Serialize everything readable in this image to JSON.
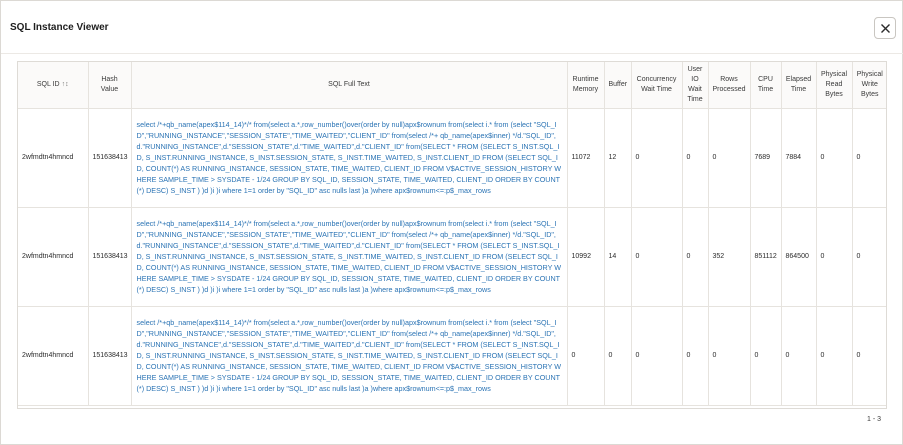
{
  "dialog": {
    "title": "SQL Instance Viewer",
    "close_icon": "close-icon"
  },
  "table": {
    "columns": [
      {
        "key": "sql_id",
        "label": "SQL ID"
      },
      {
        "key": "hash_value",
        "label": "Hash Value"
      },
      {
        "key": "sql_full_text",
        "label": "SQL Full Text"
      },
      {
        "key": "runtime_memory",
        "label": "Runtime Memory"
      },
      {
        "key": "buffer",
        "label": "Buffer"
      },
      {
        "key": "concurrency_wait_time",
        "label": "Concurrency Wait Time"
      },
      {
        "key": "user_io_wait_time",
        "label": "User IO Wait Time"
      },
      {
        "key": "rows_processed",
        "label": "Rows Processed"
      },
      {
        "key": "cpu_time",
        "label": "CPU Time"
      },
      {
        "key": "elapsed_time",
        "label": "Elapsed Time"
      },
      {
        "key": "physical_read_bytes",
        "label": "Physical Read Bytes"
      },
      {
        "key": "physical_write_bytes",
        "label": "Physical Write Bytes"
      }
    ],
    "sort_icon": "sort-ascending-icon",
    "rows": [
      {
        "sql_id": "2wfmdtn4hmncd",
        "hash_value": "151638413",
        "sql_full_text": "select /*+qb_name(apex$114_14)*/* from(select a.*,row_number()over(order by null)apx$rownum from(select i.* from (select \"SQL_ID\",\"RUNNING_INSTANCE\",\"SESSION_STATE\",\"TIME_WAITED\",\"CLIENT_ID\" from(select /*+ qb_name(apex$inner) */d.\"SQL_ID\",d.\"RUNNING_INSTANCE\",d.\"SESSION_STATE\",d.\"TIME_WAITED\",d.\"CLIENT_ID\" from(SELECT * FROM (SELECT S_INST.SQL_ID, S_INST.RUNNING_INSTANCE, S_INST.SESSION_STATE, S_INST.TIME_WAITED, S_INST.CLIENT_ID FROM (SELECT SQL_ID, COUNT(*) AS RUNNING_INSTANCE, SESSION_STATE, TIME_WAITED, CLIENT_ID FROM V$ACTIVE_SESSION_HISTORY WHERE SAMPLE_TIME > SYSDATE - 1/24 GROUP BY SQL_ID, SESSION_STATE, TIME_WAITED, CLIENT_ID ORDER BY COUNT(*) DESC) S_INST ) )d )i )i where 1=1 order by \"SQL_ID\" asc nulls last )a )where apx$rownum<=:p$_max_rows",
        "runtime_memory": "11072",
        "buffer": "12",
        "concurrency_wait_time": "0",
        "user_io_wait_time": "0",
        "rows_processed": "0",
        "cpu_time": "7689",
        "elapsed_time": "7884",
        "physical_read_bytes": "0",
        "physical_write_bytes": "0"
      },
      {
        "sql_id": "2wfmdtn4hmncd",
        "hash_value": "151638413",
        "sql_full_text": "select /*+qb_name(apex$114_14)*/* from(select a.*,row_number()over(order by null)apx$rownum from(select i.* from (select \"SQL_ID\",\"RUNNING_INSTANCE\",\"SESSION_STATE\",\"TIME_WAITED\",\"CLIENT_ID\" from(select /*+ qb_name(apex$inner) */d.\"SQL_ID\",d.\"RUNNING_INSTANCE\",d.\"SESSION_STATE\",d.\"TIME_WAITED\",d.\"CLIENT_ID\" from(SELECT * FROM (SELECT S_INST.SQL_ID, S_INST.RUNNING_INSTANCE, S_INST.SESSION_STATE, S_INST.TIME_WAITED, S_INST.CLIENT_ID FROM (SELECT SQL_ID, COUNT(*) AS RUNNING_INSTANCE, SESSION_STATE, TIME_WAITED, CLIENT_ID FROM V$ACTIVE_SESSION_HISTORY WHERE SAMPLE_TIME > SYSDATE - 1/24 GROUP BY SQL_ID, SESSION_STATE, TIME_WAITED, CLIENT_ID ORDER BY COUNT(*) DESC) S_INST ) )d )i )i where 1=1 order by \"SQL_ID\" asc nulls last )a )where apx$rownum<=:p$_max_rows",
        "runtime_memory": "10992",
        "buffer": "14",
        "concurrency_wait_time": "0",
        "user_io_wait_time": "0",
        "rows_processed": "352",
        "cpu_time": "851112",
        "elapsed_time": "864500",
        "physical_read_bytes": "0",
        "physical_write_bytes": "0"
      },
      {
        "sql_id": "2wfmdtn4hmncd",
        "hash_value": "151638413",
        "sql_full_text": "select /*+qb_name(apex$114_14)*/* from(select a.*,row_number()over(order by null)apx$rownum from(select i.* from (select \"SQL_ID\",\"RUNNING_INSTANCE\",\"SESSION_STATE\",\"TIME_WAITED\",\"CLIENT_ID\" from(select /*+ qb_name(apex$inner) */d.\"SQL_ID\",d.\"RUNNING_INSTANCE\",d.\"SESSION_STATE\",d.\"TIME_WAITED\",d.\"CLIENT_ID\" from(SELECT * FROM (SELECT S_INST.SQL_ID, S_INST.RUNNING_INSTANCE, S_INST.SESSION_STATE, S_INST.TIME_WAITED, S_INST.CLIENT_ID FROM (SELECT SQL_ID, COUNT(*) AS RUNNING_INSTANCE, SESSION_STATE, TIME_WAITED, CLIENT_ID FROM V$ACTIVE_SESSION_HISTORY WHERE SAMPLE_TIME > SYSDATE - 1/24 GROUP BY SQL_ID, SESSION_STATE, TIME_WAITED, CLIENT_ID ORDER BY COUNT(*) DESC) S_INST ) )d )i )i where 1=1 order by \"SQL_ID\" asc nulls last )a )where apx$rownum<=:p$_max_rows",
        "runtime_memory": "0",
        "buffer": "0",
        "concurrency_wait_time": "0",
        "user_io_wait_time": "0",
        "rows_processed": "0",
        "cpu_time": "0",
        "elapsed_time": "0",
        "physical_read_bytes": "0",
        "physical_write_bytes": "0"
      }
    ]
  },
  "pagination": {
    "label": "1 - 3"
  }
}
